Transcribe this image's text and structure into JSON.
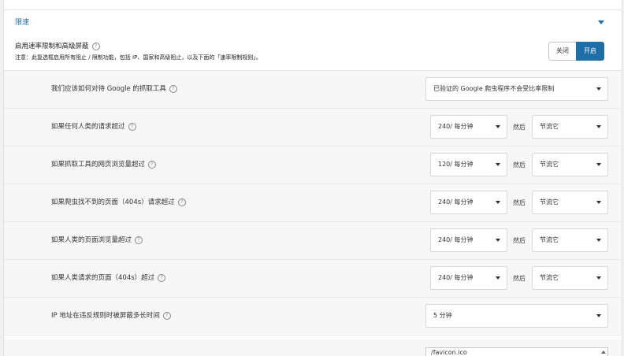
{
  "section": {
    "title": "限速"
  },
  "master": {
    "title": "启用速率限制和高级屏蔽",
    "note": "注意：此复选框启用所有阻止 / 限制功能，包括 IP、国家和高级阻止，以及下面的「速率限制规则」。",
    "toggle_off": "关闭",
    "toggle_on": "开启",
    "state": "on"
  },
  "rules": [
    {
      "label": "我们应该如何对待 Google 的抓取工具",
      "select": "已验证的 Google 爬虫程序不会受比率限制",
      "then": null,
      "action": null
    },
    {
      "label": "如果任何人类的请求超过",
      "select": "240/ 每分钟",
      "then": "然后",
      "action": "节流它"
    },
    {
      "label": "如果抓取工具的网页浏览量超过",
      "select": "120/ 每分钟",
      "then": "然后",
      "action": "节流它"
    },
    {
      "label": "如果爬虫找不到的页面（404s）请求超过",
      "select": "240/ 每分钟",
      "then": "然后",
      "action": "节流它"
    },
    {
      "label": "如果人类的页面浏览量超过",
      "select": "240/ 每分钟",
      "then": "然后",
      "action": "节流它"
    },
    {
      "label": "如果人类请求的页面（404s）超过",
      "select": "240/ 每分钟",
      "then": "然后",
      "action": "节流它"
    },
    {
      "label": "IP 地址在违反规则时被屏蔽多长时间",
      "select": "5 分钟",
      "then": null,
      "action": null
    }
  ],
  "allowlist": {
    "value": "/favicon.ico"
  },
  "colors": {
    "accent": "#1e6ea8"
  }
}
